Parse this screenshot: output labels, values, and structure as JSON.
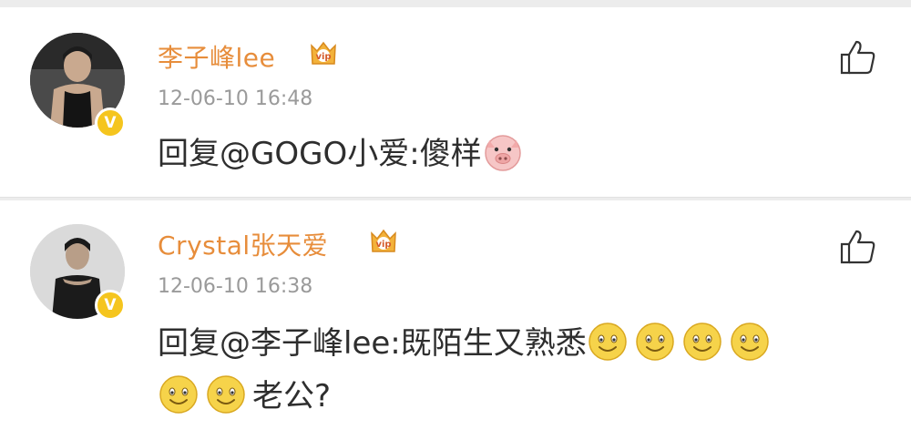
{
  "comments": [
    {
      "username": "李子峰lee",
      "time": "12-06-10 16:48",
      "reply_prefix": "回复",
      "reply_target": "@GOGO小爱",
      "separator": ":",
      "body": "傻样",
      "emoticons": [
        "pig-emoticon"
      ]
    },
    {
      "username": "Crystal张天爱",
      "time": "12-06-10 16:38",
      "reply_prefix": "回复",
      "reply_target": "@李子峰lee",
      "separator": ":",
      "body": "既陌生又熟悉",
      "emoticons": [
        "smile-emoticon",
        "smile-emoticon",
        "smile-emoticon",
        "smile-emoticon",
        "smile-emoticon",
        "smile-emoticon"
      ],
      "body_tail": "老公?"
    }
  ],
  "colors": {
    "username": "#e78d3b",
    "badge": "#f5c51e",
    "timestamp": "#9a9a9a",
    "text": "#2e2e2e"
  },
  "badge_label": "V"
}
